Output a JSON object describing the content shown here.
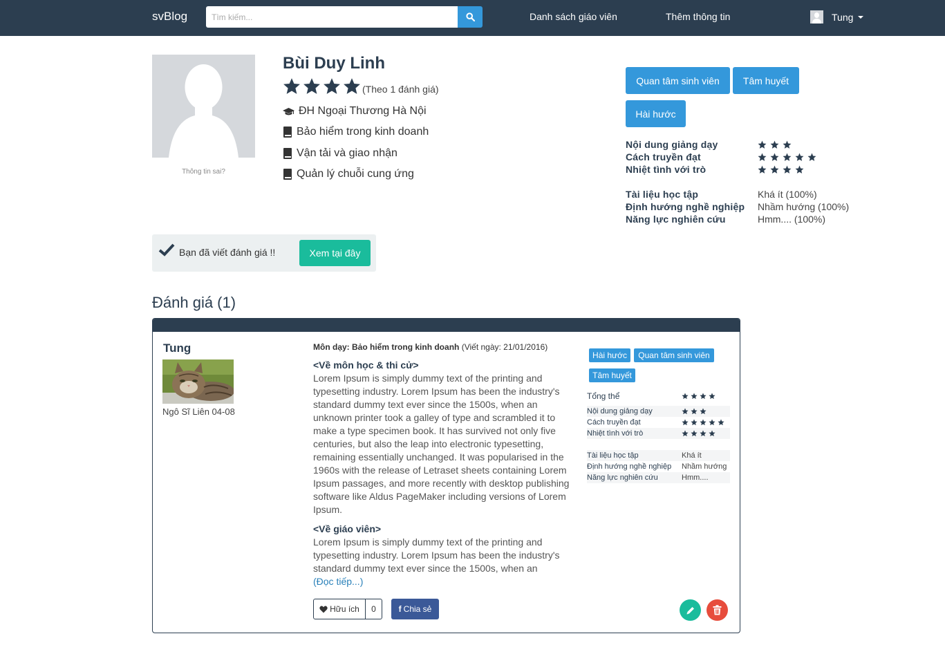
{
  "navbar": {
    "brand": "svBlog",
    "search_placeholder": "Tìm kiếm...",
    "links": [
      "Danh sách giáo viên",
      "Thêm thông tin"
    ],
    "user_name": "Tung"
  },
  "teacher": {
    "name": "Bùi Duy Linh",
    "rating_stars": 4,
    "rating_note": "(Theo 1 đánh giá)",
    "wrong_info": "Thông tin sai?",
    "university": "ĐH Ngoại Thương Hà Nội",
    "subjects": [
      "Bảo hiểm trong kinh doanh",
      "Vận tải và giao nhận",
      "Quản lý chuỗi cung ứng"
    ]
  },
  "tags": [
    "Quan tâm sinh viên",
    "Tâm huyết",
    "Hài hước"
  ],
  "criteria_stars": [
    {
      "label": "Nội dung giảng dạy",
      "stars": 3
    },
    {
      "label": "Cách truyền đạt",
      "stars": 5
    },
    {
      "label": "Nhiệt tình với trò",
      "stars": 4
    }
  ],
  "criteria_text": [
    {
      "label": "Tài liệu học tập",
      "value": "Khá ít (100%)"
    },
    {
      "label": "Định hướng nghề nghiệp",
      "value": "Nhầm hướng (100%)"
    },
    {
      "label": "Năng lực nghiên cứu",
      "value": "Hmm.... (100%)"
    }
  ],
  "done_banner": {
    "text": "Bạn đã viết đánh giá !!",
    "button": "Xem tại đây"
  },
  "reviews_title": "Đánh giá (1)",
  "review": {
    "user": "Tung",
    "class": "Ngô Sĩ Liên 04-08",
    "subject_label": "Môn dạy:",
    "subject": "Bảo hiểm trong kinh doanh",
    "date": "(Viết ngày: 21/01/2016)",
    "heading1": "<Về môn học & thi cử>",
    "text1": "Lorem Ipsum is simply dummy text of the printing and typesetting industry. Lorem Ipsum has been the industry's standard dummy text ever since the 1500s, when an unknown printer took a galley of type and scrambled it to make a type specimen book. It has survived not only five centuries, but also the leap into electronic typesetting, remaining essentially unchanged. It was popularised in the 1960s with the release of Letraset sheets containing Lorem Ipsum passages, and more recently with desktop publishing software like Aldus PageMaker including versions of Lorem Ipsum.",
    "heading2": "<Về giáo viên>",
    "text2": "Lorem Ipsum is simply dummy text of the printing and typesetting industry. Lorem Ipsum has been the industry's standard dummy text ever since the 1500s, when an",
    "read_more": "(Đọc tiếp...)",
    "useful_label": "Hữu ích",
    "useful_count": "0",
    "share_label": "Chia sẻ",
    "tags": [
      "Hài hước",
      "Quan tâm sinh viên",
      "Tâm huyết"
    ],
    "overall_label": "Tổng thể",
    "overall_stars": 4,
    "criteria_stars": [
      {
        "label": "Nội dung giảng dạy",
        "stars": 3
      },
      {
        "label": "Cách truyền đạt",
        "stars": 5
      },
      {
        "label": "Nhiệt tình với trò",
        "stars": 4
      }
    ],
    "criteria_text": [
      {
        "label": "Tài liệu học tập",
        "value": "Khá ít"
      },
      {
        "label": "Định hướng nghề nghiệp",
        "value": "Nhầm hướng"
      },
      {
        "label": "Năng lực nghiên cứu",
        "value": "Hmm...."
      }
    ]
  },
  "colors": {
    "navbar": "#2c3e50",
    "primary": "#3498db",
    "success": "#1abc9c",
    "danger": "#e74c3c",
    "facebook": "#3b5998"
  }
}
